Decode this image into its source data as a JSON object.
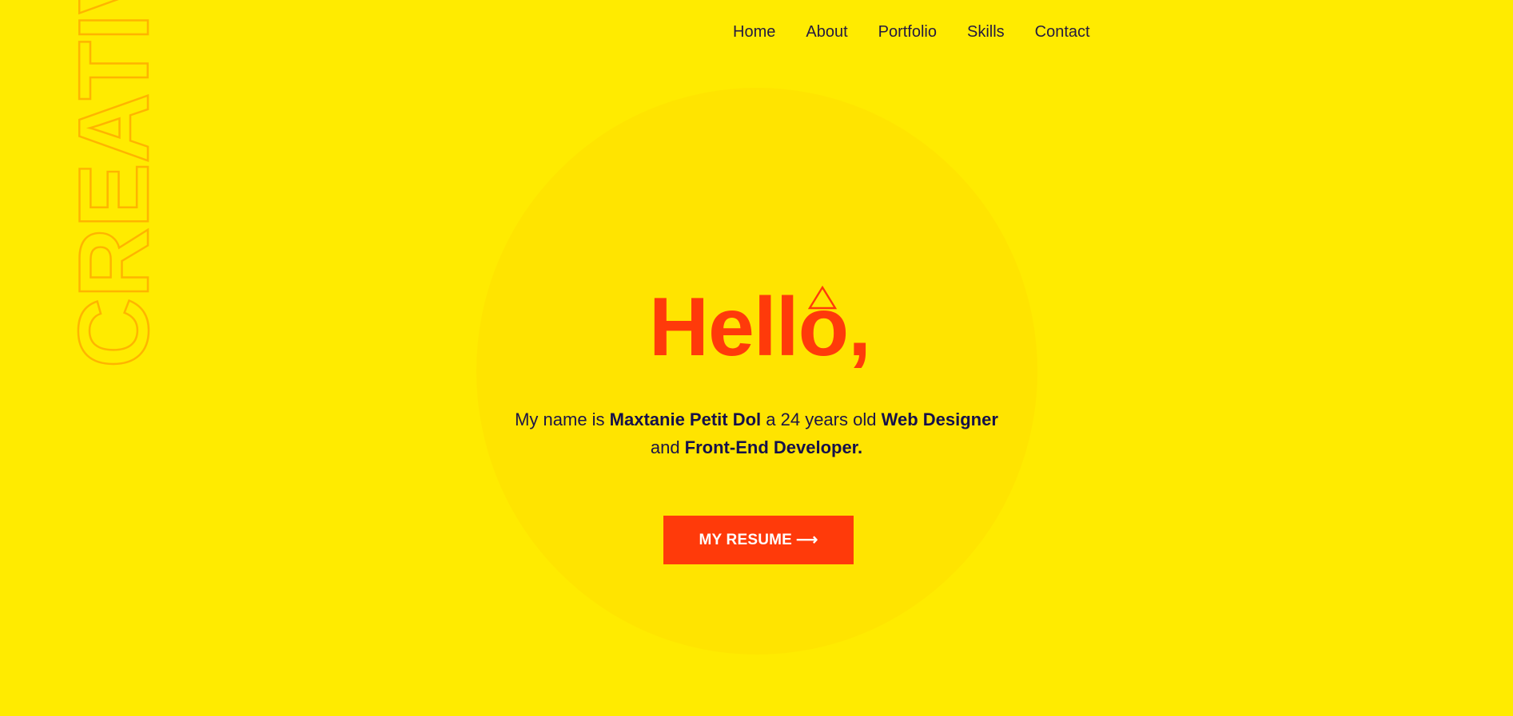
{
  "colors": {
    "background": "#FFEB00",
    "circle": "#FFE400",
    "accent": "#FF3A0A",
    "outline": "#FFB400",
    "text": "#1c1446"
  },
  "nav": {
    "items": [
      "Home",
      "About",
      "Portfolio",
      "Skills",
      "Contact"
    ]
  },
  "side_word": "CREATIVITY",
  "hero": {
    "title": "Hello,",
    "line1_prefix": "My name is ",
    "name": "Maxtanie Petit Dol",
    "line1_mid": " a 24 years old ",
    "role1": "Web Designer",
    "line2_prefix": "and ",
    "role2": "Front-End Developer.",
    "button_label": "MY RESUME",
    "button_arrow": "⟶",
    "title_icon": "triangle-outline-icon"
  }
}
